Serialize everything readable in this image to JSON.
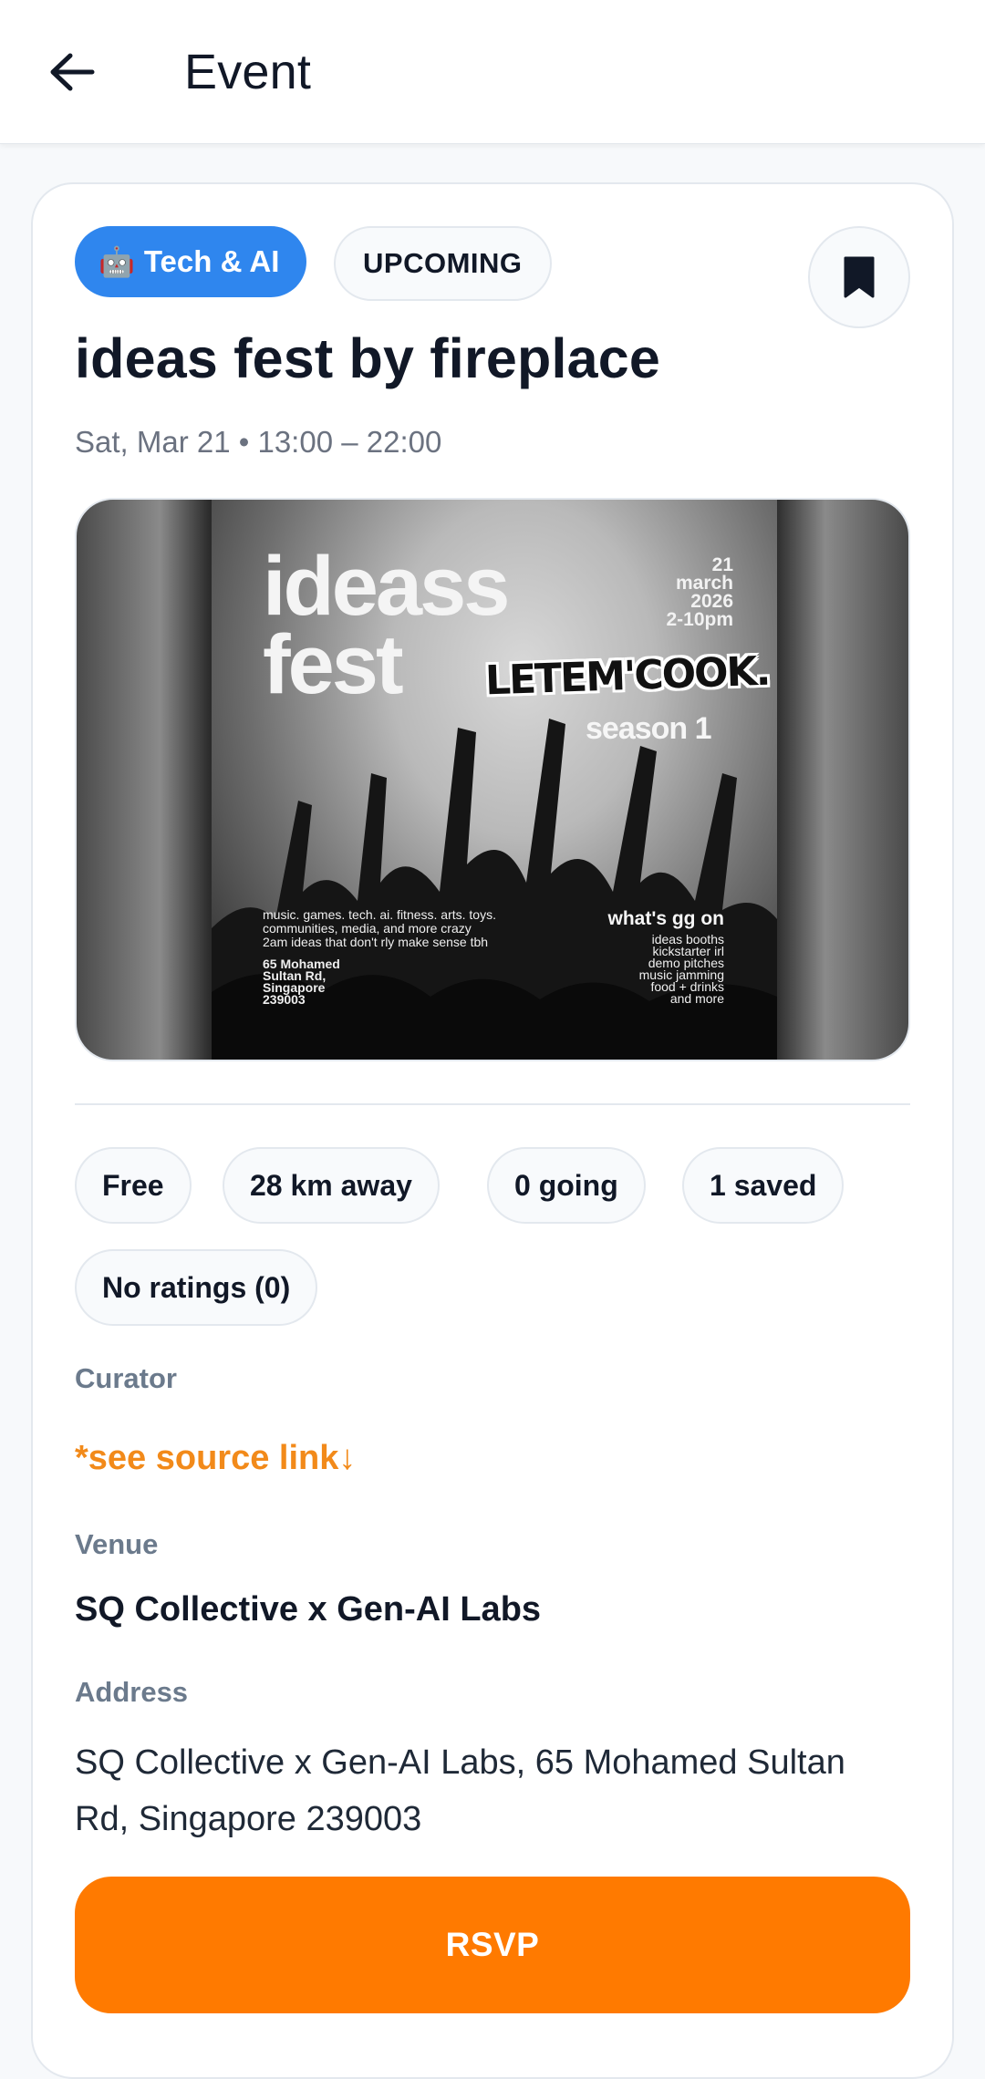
{
  "appbar": {
    "title": "Event",
    "back_icon": "arrow-left-icon"
  },
  "event": {
    "category": {
      "emoji": "🤖",
      "label": "Tech & AI",
      "color": "#2f86ee"
    },
    "status": "UPCOMING",
    "bookmark_icon": "bookmark-icon",
    "title": "ideas fest by fireplace",
    "datetime": "Sat, Mar 21 • 13:00 – 22:00"
  },
  "poster": {
    "headline_line1": "ideass",
    "headline_line2": "fest",
    "date_lines": [
      "21",
      "march",
      "2026",
      "2-10pm"
    ],
    "tagline": "LETEM'COOK.",
    "season": "season 1",
    "description_lines": [
      "music. games. tech. ai. fitness. arts. toys.",
      "communities, media, and more crazy",
      "2am ideas that don't rly make sense tbh"
    ],
    "address_lines": [
      "65 Mohamed",
      "Sultan Rd,",
      "Singapore",
      "239003"
    ],
    "whats_on_title": "what's gg on",
    "whats_on_items": [
      "ideas booths",
      "kickstarter irl",
      "demo pitches",
      "music jamming",
      "food + drinks",
      "and more"
    ]
  },
  "stats": {
    "price": "Free",
    "distance": "28 km away",
    "going": "0 going",
    "saved": "1 saved",
    "ratings": "No ratings (0)"
  },
  "details": {
    "curator_label": "Curator",
    "curator_value": "*see source link↓",
    "venue_label": "Venue",
    "venue_value": "SQ Collective x Gen-AI Labs",
    "address_label": "Address",
    "address_value": "SQ Collective x Gen-AI Labs, 65 Mohamed Sultan Rd, Singapore 239003"
  },
  "actions": {
    "rsvp_label": "RSVP",
    "rsvp_color": "#ff7a00"
  }
}
